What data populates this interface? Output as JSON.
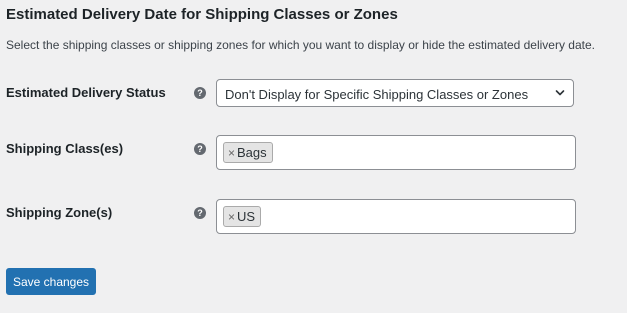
{
  "section": {
    "title": "Estimated Delivery Date for Shipping Classes or Zones",
    "description": "Select the shipping classes or shipping zones for which you want to display or hide the estimated delivery date."
  },
  "fields": {
    "status": {
      "label": "Estimated Delivery Status",
      "help_icon": "question-circle",
      "selected": "Don't Display for Specific Shipping Classes or Zones",
      "dropdown_icon": "chevron-down"
    },
    "shipping_classes": {
      "label": "Shipping Class(es)",
      "help_icon": "question-circle",
      "tags": [
        "Bags"
      ],
      "remove_glyph": "×"
    },
    "shipping_zones": {
      "label": "Shipping Zone(s)",
      "help_icon": "question-circle",
      "tags": [
        "US"
      ],
      "remove_glyph": "×"
    }
  },
  "actions": {
    "save_label": "Save changes"
  },
  "colors": {
    "background": "#f0f0f1",
    "primary_button": "#2271b1",
    "help_icon": "#646970"
  }
}
